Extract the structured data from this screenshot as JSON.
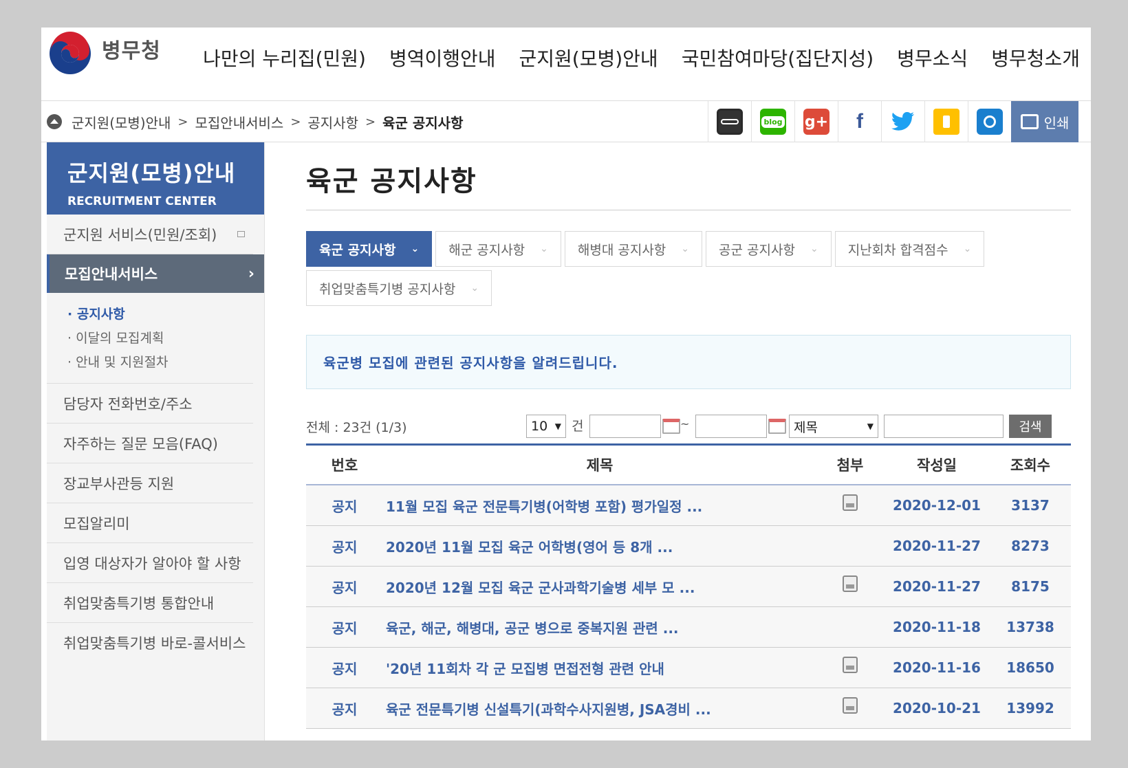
{
  "header": {
    "logo_text": "병무청",
    "nav": [
      "나만의 누리집(민원)",
      "병역이행안내",
      "군지원(모병)안내",
      "국민참여마당(집단지성)",
      "병무소식",
      "병무청소개"
    ]
  },
  "breadcrumb": {
    "items": [
      "군지원(모병)안내",
      "모집안내서비스",
      "공지사항"
    ],
    "separator": ">",
    "current": "육군 공지사항"
  },
  "share": {
    "icons": [
      "band-icon",
      "blog-icon",
      "google-plus-icon",
      "facebook-icon",
      "twitter-icon",
      "kakaostory-icon",
      "link-icon"
    ],
    "blog_text": "blog",
    "gplus_text": "g+",
    "facebook_text": "f",
    "print_label": "인쇄"
  },
  "sidebar": {
    "title": "군지원(모병)안내",
    "subtitle": "RECRUITMENT CENTER",
    "item_service": "군지원 서비스(민원/조회)",
    "active": "모집안내서비스",
    "active_arrow": "›",
    "sub_items": [
      "공지사항",
      "이달의 모집계획",
      "안내 및 지원절차"
    ],
    "items": [
      "담당자 전화번호/주소",
      "자주하는 질문 모음(FAQ)",
      "장교부사관등 지원",
      "모집알리미",
      "입영 대상자가 알아야 할 사항",
      "취업맞춤특기병 통합안내",
      "취업맞춤특기병 바로-콜서비스"
    ]
  },
  "main": {
    "title": "육군 공지사항",
    "tabs": [
      "육군 공지사항",
      "해군 공지사항",
      "해병대 공지사항",
      "공군 공지사항",
      "지난회차 합격점수",
      "취업맞춤특기병 공지사항"
    ],
    "notice": "육군병 모집에 관련된 공지사항을 알려드립니다.",
    "total": "전체 : 23건 (1/3)",
    "page_size": "10",
    "page_size_unit": "건",
    "date_sep": "~",
    "search_field": "제목",
    "search_button": "검색"
  },
  "table": {
    "headers": [
      "번호",
      "제목",
      "첨부",
      "작성일",
      "조회수"
    ],
    "rows": [
      {
        "no": "공지",
        "title": "11월 모집 육군 전문특기병(어학병 포함) 평가일정 ...",
        "attach": true,
        "date": "2020-12-01",
        "views": "3137"
      },
      {
        "no": "공지",
        "title": "2020년 11월 모집 육군 어학병(영어 등 8개 ...",
        "attach": false,
        "date": "2020-11-27",
        "views": "8273"
      },
      {
        "no": "공지",
        "title": "2020년 12월 모집 육군 군사과학기술병 세부 모 ...",
        "attach": true,
        "date": "2020-11-27",
        "views": "8175"
      },
      {
        "no": "공지",
        "title": "육군, 해군, 해병대, 공군 병으로 중복지원 관련 ...",
        "attach": false,
        "date": "2020-11-18",
        "views": "13738"
      },
      {
        "no": "공지",
        "title": "'20년 11회차 각 군 모집병 면접전형 관련 안내",
        "attach": true,
        "date": "2020-11-16",
        "views": "18650"
      },
      {
        "no": "공지",
        "title": "육군 전문특기병 신설특기(과학수사지원병, JSA경비 ...",
        "attach": true,
        "date": "2020-10-21",
        "views": "13992"
      }
    ]
  },
  "colors": {
    "primary": "#3d63a4",
    "sidebar_active": "#5d6a7a",
    "print": "#5d7dae"
  }
}
